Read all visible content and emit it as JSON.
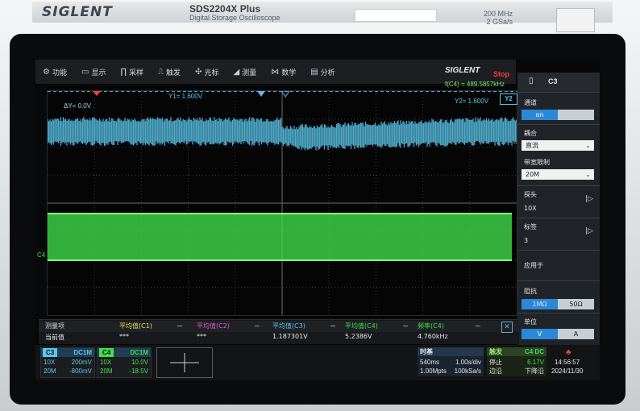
{
  "device": {
    "logo": "SIGLENT",
    "model": "SDS2204X  Plus",
    "subtitle": "Digital Storage Oscilloscope",
    "bandwidth": "200 MHz",
    "sample_rate": "2 GSa/s"
  },
  "menu": [
    {
      "icon": "gear-icon",
      "glyph": "⚙",
      "label": "功能"
    },
    {
      "icon": "display-icon",
      "glyph": "▭",
      "label": "显示"
    },
    {
      "icon": "acquire-icon",
      "glyph": "∏",
      "label": "采样"
    },
    {
      "icon": "trigger-icon",
      "glyph": "⎍",
      "label": "触发"
    },
    {
      "icon": "cursor-icon",
      "glyph": "✣",
      "label": "光标"
    },
    {
      "icon": "measure-icon",
      "glyph": "◢",
      "label": "测量"
    },
    {
      "icon": "math-icon",
      "glyph": "⋈",
      "label": "数学"
    },
    {
      "icon": "analysis-icon",
      "glyph": "▤",
      "label": "分析"
    }
  ],
  "status": {
    "brand": "SIGLENT",
    "run_state": "Stop",
    "frequency": "f(C4) = 489.5857kHz"
  },
  "plot": {
    "delta_y": "ΔY= 0.0V",
    "y1": "Y1= 1.600V",
    "y2": "Y2= 1.600V",
    "y2_tag": "Y2",
    "c4_marker": "C4",
    "trace_colors": {
      "c3": "#5bc6ec",
      "c4": "#3fe04a"
    }
  },
  "sidebar": {
    "title": "C3",
    "channel_label": "通道",
    "channel_on": "on",
    "coupling_label": "耦合",
    "coupling_value": "直流",
    "bw_label": "带宽限制",
    "bw_value": "20M",
    "probe_label": "探头",
    "probe_value": "10X",
    "tag_label": "标签",
    "tag_value": "3",
    "apply_label": "应用于",
    "impedance_label": "阻抗",
    "imp_1m": "1MΩ",
    "imp_50": "50Ω",
    "unit_label": "单位",
    "unit_v": "V",
    "unit_a": "A"
  },
  "measurements": {
    "header": [
      "测量项",
      "平均值(C1)",
      "平均值(C2)",
      "平均值(C3)",
      "平均值(C4)",
      "频率(C4)"
    ],
    "values": [
      "当前值",
      "***",
      "***",
      "1.187301V",
      "5.2386V",
      "4.760kHz"
    ],
    "header_colors": [
      "#d8d8d8",
      "#e9e04a",
      "#e158d6",
      "#5bc6ec",
      "#3fe04a",
      "#3fe04a"
    ]
  },
  "channels": [
    {
      "tag": "C3",
      "coupling": "DC1M",
      "probe": "10X",
      "scale": "200mV",
      "bw": "20M",
      "offset": "-800mV",
      "color": "#5bc6ec"
    },
    {
      "tag": "C4",
      "coupling": "DC1M",
      "probe": "10X",
      "scale": "10.0V",
      "bw": "20M",
      "offset": "-18.5V",
      "color": "#3fe04a"
    }
  ],
  "timebase": {
    "title": "时基",
    "delay": "540ms",
    "scale": "1.00s/div",
    "points": "1.00Mpts",
    "rate": "100kSa/s"
  },
  "trigger": {
    "title": "触发",
    "source": "C4 DC",
    "state": "停止",
    "level": "6.17V",
    "mode": "边沿",
    "slope": "下降沿"
  },
  "clock": {
    "time": "14:56:57",
    "date": "2024/11/30"
  }
}
